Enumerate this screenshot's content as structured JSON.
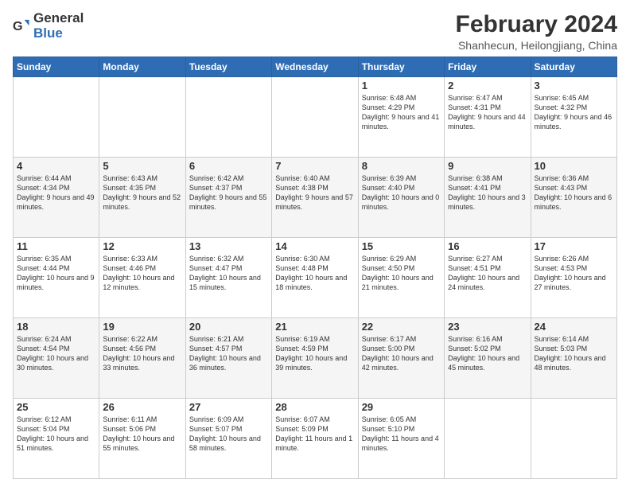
{
  "logo": {
    "text_general": "General",
    "text_blue": "Blue"
  },
  "title": "February 2024",
  "subtitle": "Shanhecun, Heilongjiang, China",
  "days_of_week": [
    "Sunday",
    "Monday",
    "Tuesday",
    "Wednesday",
    "Thursday",
    "Friday",
    "Saturday"
  ],
  "weeks": [
    {
      "row_style": "normal-row",
      "days": [
        {
          "num": "",
          "info": ""
        },
        {
          "num": "",
          "info": ""
        },
        {
          "num": "",
          "info": ""
        },
        {
          "num": "",
          "info": ""
        },
        {
          "num": "1",
          "info": "Sunrise: 6:48 AM\nSunset: 4:29 PM\nDaylight: 9 hours and 41 minutes."
        },
        {
          "num": "2",
          "info": "Sunrise: 6:47 AM\nSunset: 4:31 PM\nDaylight: 9 hours and 44 minutes."
        },
        {
          "num": "3",
          "info": "Sunrise: 6:45 AM\nSunset: 4:32 PM\nDaylight: 9 hours and 46 minutes."
        }
      ]
    },
    {
      "row_style": "alt-row",
      "days": [
        {
          "num": "4",
          "info": "Sunrise: 6:44 AM\nSunset: 4:34 PM\nDaylight: 9 hours and 49 minutes."
        },
        {
          "num": "5",
          "info": "Sunrise: 6:43 AM\nSunset: 4:35 PM\nDaylight: 9 hours and 52 minutes."
        },
        {
          "num": "6",
          "info": "Sunrise: 6:42 AM\nSunset: 4:37 PM\nDaylight: 9 hours and 55 minutes."
        },
        {
          "num": "7",
          "info": "Sunrise: 6:40 AM\nSunset: 4:38 PM\nDaylight: 9 hours and 57 minutes."
        },
        {
          "num": "8",
          "info": "Sunrise: 6:39 AM\nSunset: 4:40 PM\nDaylight: 10 hours and 0 minutes."
        },
        {
          "num": "9",
          "info": "Sunrise: 6:38 AM\nSunset: 4:41 PM\nDaylight: 10 hours and 3 minutes."
        },
        {
          "num": "10",
          "info": "Sunrise: 6:36 AM\nSunset: 4:43 PM\nDaylight: 10 hours and 6 minutes."
        }
      ]
    },
    {
      "row_style": "normal-row",
      "days": [
        {
          "num": "11",
          "info": "Sunrise: 6:35 AM\nSunset: 4:44 PM\nDaylight: 10 hours and 9 minutes."
        },
        {
          "num": "12",
          "info": "Sunrise: 6:33 AM\nSunset: 4:46 PM\nDaylight: 10 hours and 12 minutes."
        },
        {
          "num": "13",
          "info": "Sunrise: 6:32 AM\nSunset: 4:47 PM\nDaylight: 10 hours and 15 minutes."
        },
        {
          "num": "14",
          "info": "Sunrise: 6:30 AM\nSunset: 4:48 PM\nDaylight: 10 hours and 18 minutes."
        },
        {
          "num": "15",
          "info": "Sunrise: 6:29 AM\nSunset: 4:50 PM\nDaylight: 10 hours and 21 minutes."
        },
        {
          "num": "16",
          "info": "Sunrise: 6:27 AM\nSunset: 4:51 PM\nDaylight: 10 hours and 24 minutes."
        },
        {
          "num": "17",
          "info": "Sunrise: 6:26 AM\nSunset: 4:53 PM\nDaylight: 10 hours and 27 minutes."
        }
      ]
    },
    {
      "row_style": "alt-row",
      "days": [
        {
          "num": "18",
          "info": "Sunrise: 6:24 AM\nSunset: 4:54 PM\nDaylight: 10 hours and 30 minutes."
        },
        {
          "num": "19",
          "info": "Sunrise: 6:22 AM\nSunset: 4:56 PM\nDaylight: 10 hours and 33 minutes."
        },
        {
          "num": "20",
          "info": "Sunrise: 6:21 AM\nSunset: 4:57 PM\nDaylight: 10 hours and 36 minutes."
        },
        {
          "num": "21",
          "info": "Sunrise: 6:19 AM\nSunset: 4:59 PM\nDaylight: 10 hours and 39 minutes."
        },
        {
          "num": "22",
          "info": "Sunrise: 6:17 AM\nSunset: 5:00 PM\nDaylight: 10 hours and 42 minutes."
        },
        {
          "num": "23",
          "info": "Sunrise: 6:16 AM\nSunset: 5:02 PM\nDaylight: 10 hours and 45 minutes."
        },
        {
          "num": "24",
          "info": "Sunrise: 6:14 AM\nSunset: 5:03 PM\nDaylight: 10 hours and 48 minutes."
        }
      ]
    },
    {
      "row_style": "normal-row",
      "days": [
        {
          "num": "25",
          "info": "Sunrise: 6:12 AM\nSunset: 5:04 PM\nDaylight: 10 hours and 51 minutes."
        },
        {
          "num": "26",
          "info": "Sunrise: 6:11 AM\nSunset: 5:06 PM\nDaylight: 10 hours and 55 minutes."
        },
        {
          "num": "27",
          "info": "Sunrise: 6:09 AM\nSunset: 5:07 PM\nDaylight: 10 hours and 58 minutes."
        },
        {
          "num": "28",
          "info": "Sunrise: 6:07 AM\nSunset: 5:09 PM\nDaylight: 11 hours and 1 minute."
        },
        {
          "num": "29",
          "info": "Sunrise: 6:05 AM\nSunset: 5:10 PM\nDaylight: 11 hours and 4 minutes."
        },
        {
          "num": "",
          "info": ""
        },
        {
          "num": "",
          "info": ""
        }
      ]
    }
  ]
}
